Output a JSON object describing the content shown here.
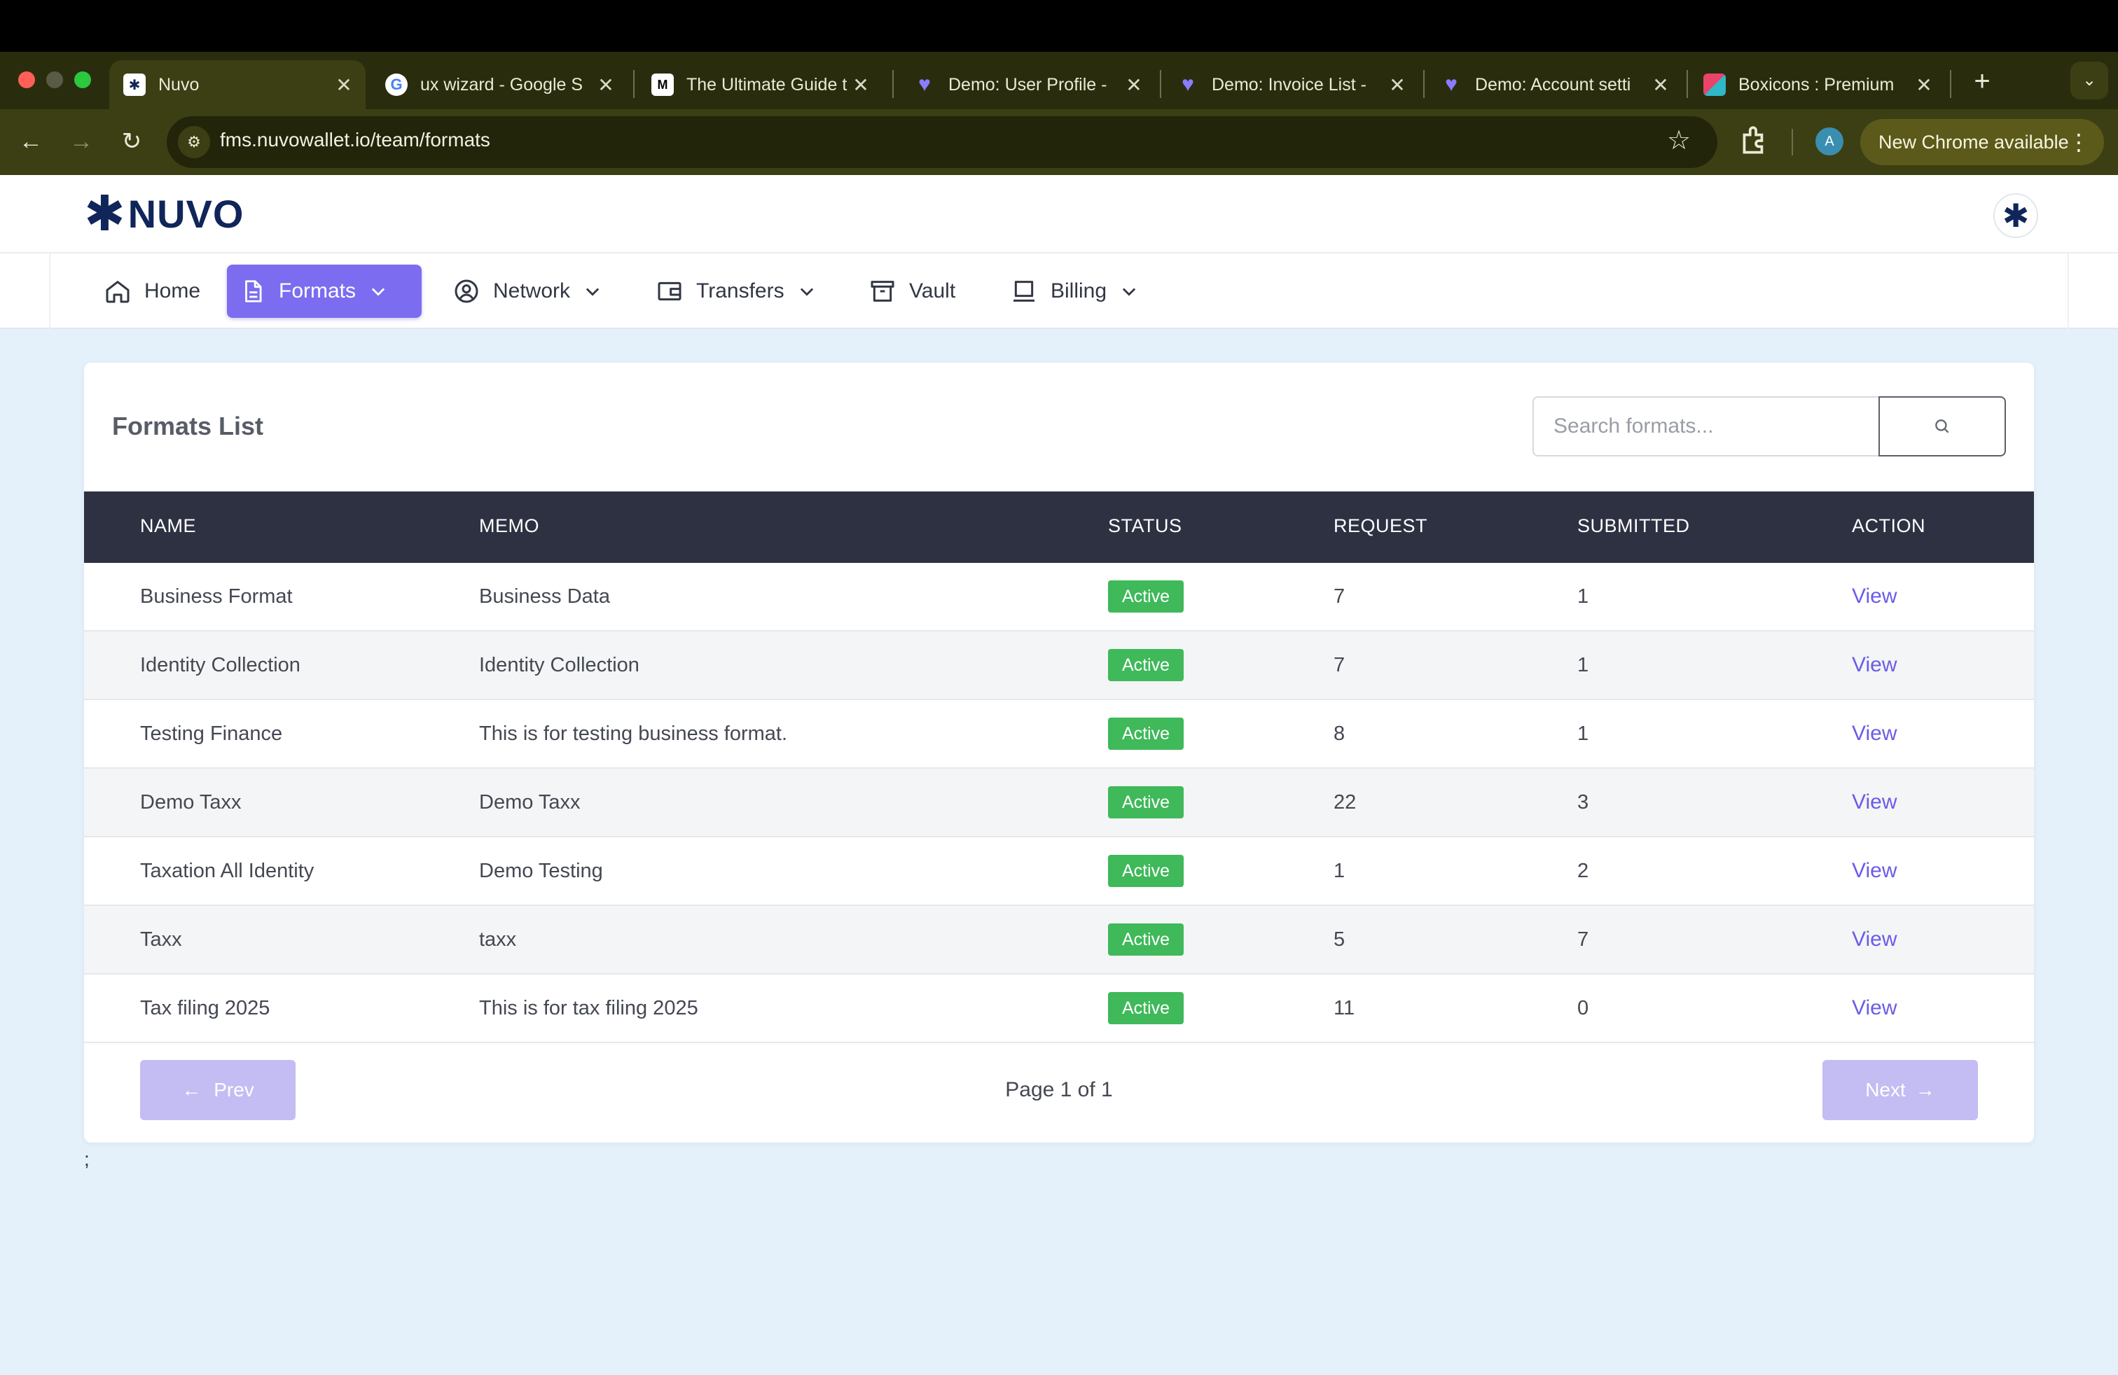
{
  "browser": {
    "tabs": [
      {
        "title": "Nuvo",
        "favicon": "nuvo-favicon",
        "active": true
      },
      {
        "title": "ux wizard - Google S",
        "favicon": "google-favicon"
      },
      {
        "title": "The Ultimate Guide t",
        "favicon": "medium-favicon"
      },
      {
        "title": "Demo: User Profile -",
        "favicon": "demo-favicon"
      },
      {
        "title": "Demo: Invoice List -",
        "favicon": "demo-favicon"
      },
      {
        "title": "Demo: Account setti",
        "favicon": "demo-favicon"
      },
      {
        "title": "Boxicons : Premium",
        "favicon": "boxicons-favicon"
      }
    ],
    "url": "fms.nuvowallet.io/team/formats",
    "update_label": "New Chrome available",
    "profile_initial": "A"
  },
  "app": {
    "logo_text": "NUVO",
    "nav": [
      {
        "label": "Home",
        "icon": "home-icon",
        "dropdown": false
      },
      {
        "label": "Formats",
        "icon": "document-icon",
        "dropdown": true,
        "active": true
      },
      {
        "label": "Network",
        "icon": "user-circle-icon",
        "dropdown": true
      },
      {
        "label": "Transfers",
        "icon": "wallet-icon",
        "dropdown": true
      },
      {
        "label": "Vault",
        "icon": "archive-icon",
        "dropdown": false
      },
      {
        "label": "Billing",
        "icon": "laptop-icon",
        "dropdown": true
      }
    ]
  },
  "card": {
    "title": "Formats List",
    "search_placeholder": "Search formats..."
  },
  "table": {
    "columns": [
      "NAME",
      "MEMO",
      "STATUS",
      "REQUEST",
      "SUBMITTED",
      "ACTION"
    ],
    "rows": [
      {
        "name": "Business Format",
        "memo": "Business Data",
        "status": "Active",
        "request": "7",
        "submitted": "1",
        "action": "View"
      },
      {
        "name": "Identity Collection",
        "memo": "Identity Collection",
        "status": "Active",
        "request": "7",
        "submitted": "1",
        "action": "View"
      },
      {
        "name": "Testing Finance",
        "memo": "This is for testing business format.",
        "status": "Active",
        "request": "8",
        "submitted": "1",
        "action": "View"
      },
      {
        "name": "Demo Taxx",
        "memo": "Demo Taxx",
        "status": "Active",
        "request": "22",
        "submitted": "3",
        "action": "View"
      },
      {
        "name": "Taxation All Identity",
        "memo": "Demo Testing",
        "status": "Active",
        "request": "1",
        "submitted": "2",
        "action": "View"
      },
      {
        "name": "Taxx",
        "memo": "taxx",
        "status": "Active",
        "request": "5",
        "submitted": "7",
        "action": "View"
      },
      {
        "name": "Tax filing 2025",
        "memo": "This is for tax filing 2025",
        "status": "Active",
        "request": "11",
        "submitted": "0",
        "action": "View"
      }
    ]
  },
  "pagination": {
    "prev_label": "Prev",
    "next_label": "Next",
    "page_text": "Page 1 of 1"
  },
  "stray_text": ";",
  "colors": {
    "accent": "#7b6cf0",
    "status_active": "#3fb95a",
    "table_header": "#2d3142",
    "page_bg": "#e4f0fa"
  }
}
